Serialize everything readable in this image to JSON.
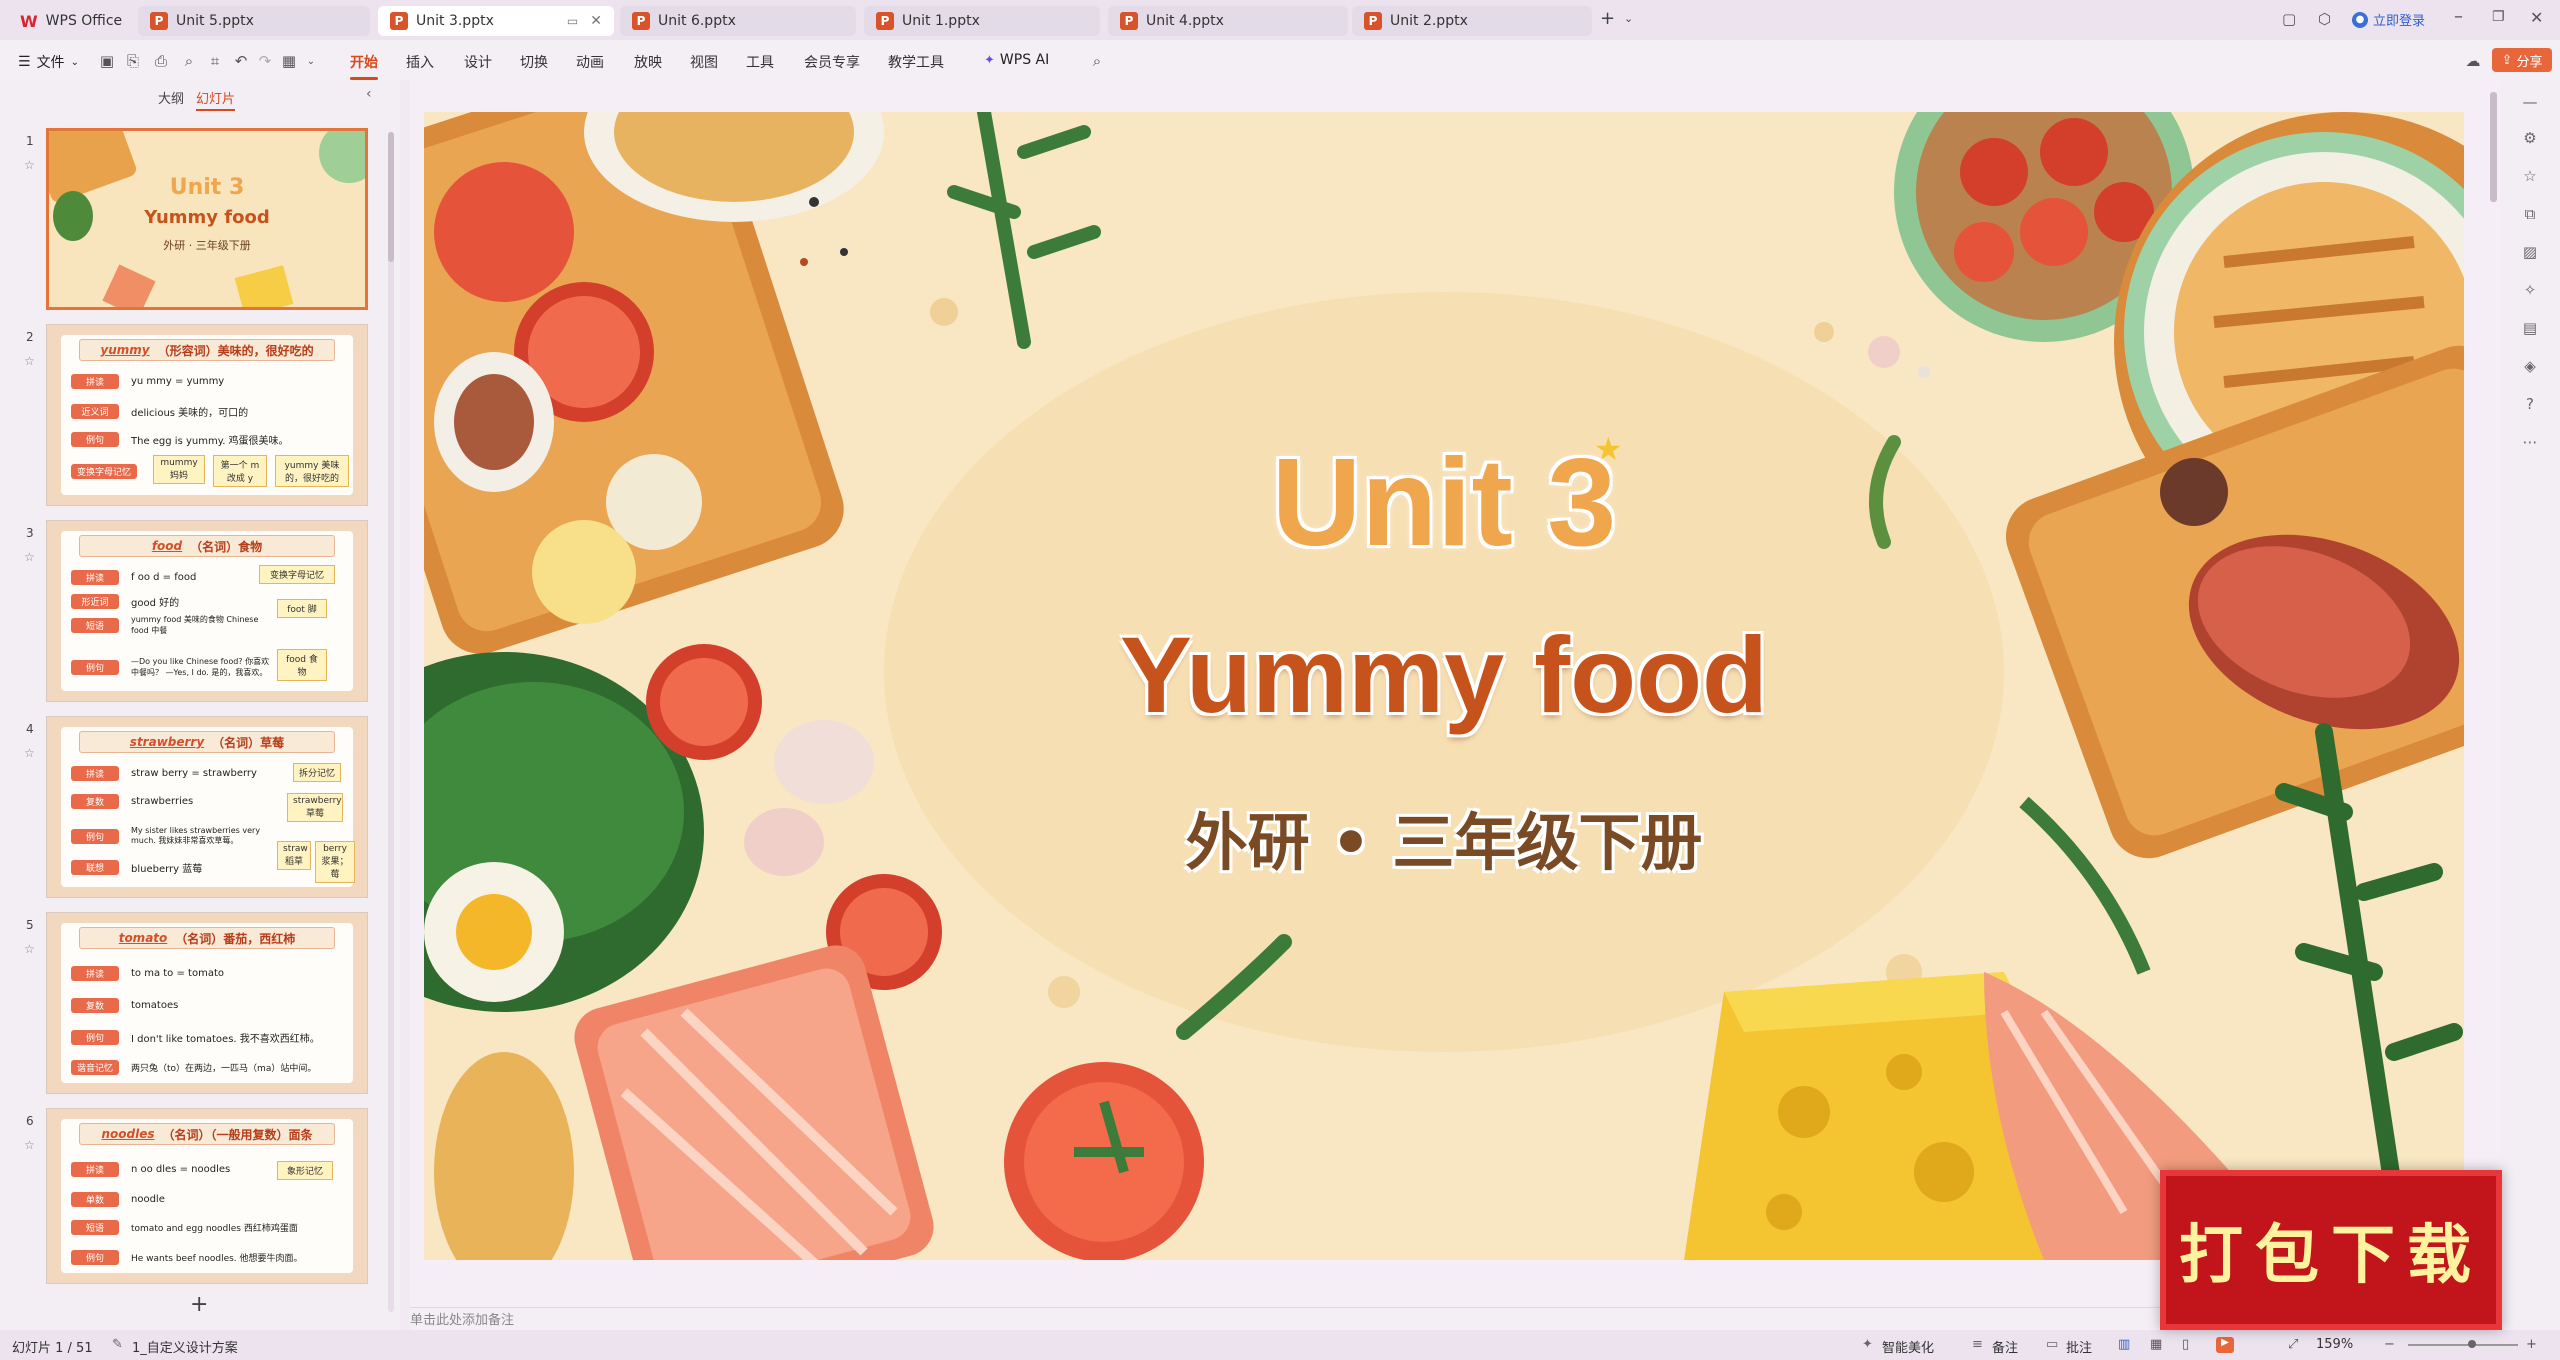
{
  "tabs": [
    {
      "label": "WPS Office",
      "icon": "wps-logo-icon"
    },
    {
      "label": "Unit 5.pptx"
    },
    {
      "label": "Unit 3.pptx",
      "active": true
    },
    {
      "label": "Unit 6.pptx"
    },
    {
      "label": "Unit 1.pptx"
    },
    {
      "label": "Unit 4.pptx"
    },
    {
      "label": "Unit 2.pptx"
    }
  ],
  "window": {
    "login": "立即登录",
    "share": "分享"
  },
  "menu": {
    "file": "文件",
    "items": [
      "开始",
      "插入",
      "设计",
      "切换",
      "动画",
      "放映",
      "视图",
      "工具",
      "会员专享",
      "教学工具"
    ],
    "ai": "WPS AI"
  },
  "sidebar": {
    "tab_outline": "大纲",
    "tab_slides": "幻灯片",
    "add": "+"
  },
  "thumbs": [
    {
      "num": "1",
      "title": "Unit 3",
      "subtitle": "Yummy food",
      "caption": "外研 · 三年级下册"
    },
    {
      "num": "2",
      "word": "yummy",
      "head": "（形容词）美味的，很好吃的",
      "rows": [
        {
          "label": "拼读",
          "text": "yu  mmy = yummy"
        },
        {
          "label": "近义词",
          "text": "delicious 美味的，可口的"
        },
        {
          "label": "例句",
          "text": "The egg is yummy. 鸡蛋很美味。"
        },
        {
          "label": "变换字母记忆",
          "text": ""
        }
      ],
      "notes": [
        "mummy 妈妈",
        "第一个 m 改成 y",
        "yummy 美味的，很好吃的"
      ]
    },
    {
      "num": "3",
      "word": "food",
      "head": "（名词）食物",
      "rows": [
        {
          "label": "拼读",
          "text": "f  oo  d = food"
        },
        {
          "label": "形近词",
          "text": "good 好的"
        },
        {
          "label": "短语",
          "text": "yummy food 美味的食物  Chinese food 中餐"
        },
        {
          "label": "例句",
          "text": "—Do you like Chinese food? 你喜欢中餐吗？ —Yes, I do. 是的，我喜欢。"
        }
      ],
      "notes": [
        "变换字母记忆",
        "foot 脚",
        "food 食物"
      ]
    },
    {
      "num": "4",
      "word": "strawberry",
      "head": "（名词）草莓",
      "rows": [
        {
          "label": "拼读",
          "text": "straw  berry = strawberry"
        },
        {
          "label": "复数",
          "text": "strawberries"
        },
        {
          "label": "例句",
          "text": "My sister likes strawberries very much. 我妹妹非常喜欢草莓。"
        },
        {
          "label": "联想",
          "text": "blueberry 蓝莓"
        }
      ],
      "notes": [
        "拆分记忆",
        "strawberry 草莓",
        "straw 稻草",
        "berry 浆果；莓"
      ]
    },
    {
      "num": "5",
      "word": "tomato",
      "head": "（名词）番茄，西红柿",
      "rows": [
        {
          "label": "拼读",
          "text": "to  ma  to = tomato"
        },
        {
          "label": "复数",
          "text": "tomatoes"
        },
        {
          "label": "例句",
          "text": "I don't like tomatoes. 我不喜欢西红柿。"
        },
        {
          "label": "谐音记忆",
          "text": "两只兔（to）在两边，一匹马（ma）站中间。"
        }
      ],
      "notes": []
    },
    {
      "num": "6",
      "word": "noodles",
      "head": "（名词）（一般用复数）面条",
      "rows": [
        {
          "label": "拼读",
          "text": "n  oo  dles = noodles"
        },
        {
          "label": "单数",
          "text": "noodle"
        },
        {
          "label": "短语",
          "text": "tomato and egg noodles 西红柿鸡蛋面"
        },
        {
          "label": "例句",
          "text": "He wants beef noodles. 他想要牛肉面。"
        }
      ],
      "notes": [
        "象形记忆"
      ]
    }
  ],
  "slide": {
    "title": "Unit 3",
    "subtitle": "Yummy food",
    "caption": "外研 • 三年级下册"
  },
  "notes_placeholder": "单击此处添加备注",
  "status": {
    "slide_count": "幻灯片 1 / 51",
    "theme": "1_自定义设计方案",
    "beautify": "智能美化",
    "notes": "备注",
    "comment": "批注",
    "zoom": "159%"
  },
  "download_banner": "打包下载",
  "colors": {
    "accent": "#d84a1a",
    "title_orange": "#f0a64d",
    "subtitle_brown": "#c6531c",
    "banner_red": "#c1141b"
  }
}
